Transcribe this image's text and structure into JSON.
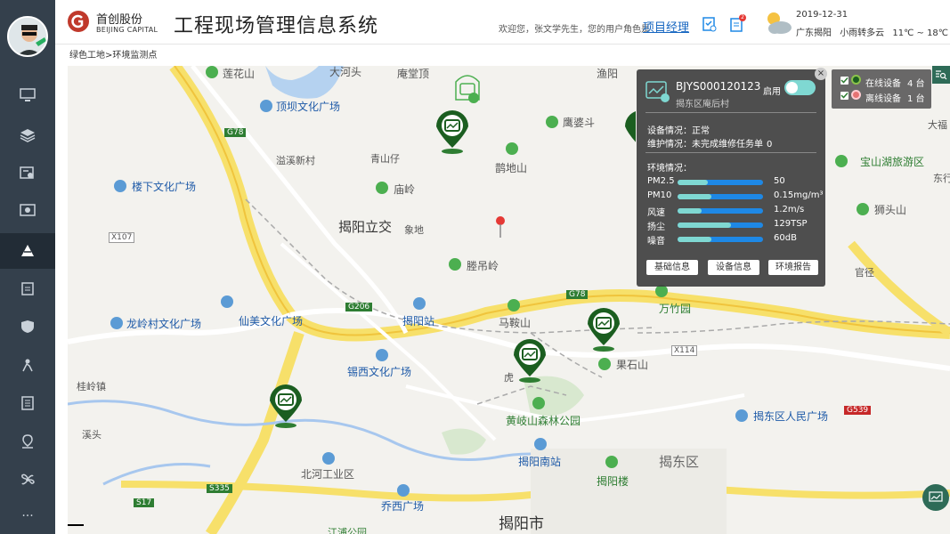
{
  "header": {
    "brand_cn": "首创股份",
    "brand_en": "BEIJING CAPITAL",
    "title": "工程现场管理信息系统",
    "welcome": "欢迎您，张文学先生，您的用户角色是",
    "role": "项目经理",
    "notice_count": "2",
    "date": "2019-12-31",
    "location": "广东揭阳",
    "weather": "小雨转多云",
    "temp": "11℃ ~ 18℃"
  },
  "breadcrumb": "绿色工地>环境监测点",
  "sidebar": {
    "items": [
      "monitor-icon",
      "layers-icon",
      "id-card-icon",
      "screen-icon",
      "crane-icon",
      "clipboard-icon",
      "shield-icon",
      "worker-icon",
      "document-icon",
      "location-icon",
      "fan-icon",
      "more-icon"
    ],
    "active_index": 4
  },
  "popup": {
    "device_id": "BJYS000120123",
    "address": "揭东区庵后村",
    "enable_label": "启用",
    "status_label": "设备情况：",
    "status_value": "正常",
    "maint_label": "维护情况：",
    "maint_value": "未完成维修任务单",
    "maint_count": "0",
    "env_label": "环境情况：",
    "metrics": [
      {
        "name": "PM2.5",
        "value": "50",
        "level": 0.35
      },
      {
        "name": "PM10",
        "value": "0.15mg/m³",
        "level": 0.4
      },
      {
        "name": "风速",
        "value": "1.2m/s",
        "level": 0.28
      },
      {
        "name": "扬尘",
        "value": "129TSP",
        "level": 0.62
      },
      {
        "name": "噪音",
        "value": "60dB",
        "level": 0.4
      }
    ],
    "buttons": [
      "基础信息",
      "设备信息",
      "环境报告"
    ]
  },
  "legend": {
    "online_label": "在线设备",
    "online_count": "4 台",
    "offline_label": "离线设备",
    "offline_count": "1 台"
  },
  "map": {
    "labels": {
      "lianhuashan": "莲花山",
      "dinghuan": "顶坝文化广场",
      "anshaicun": "溢溪新村",
      "qingshanzi": "青山仔",
      "louxia": "楼下文化广场",
      "miaoling": "庙岭",
      "jieyanglijiao": "揭阳立交",
      "xiangdi": "象地",
      "x107": "X107",
      "g78a": "G78",
      "g78b": "G78",
      "g206": "G206",
      "x114": "X114",
      "s335": "S335",
      "s17": "S17",
      "g539": "G539",
      "tengdiaoling": "塍吊岭",
      "longlingcun": "龙岭村文化广场",
      "xianmei": "仙美文化广场",
      "jieyangzhan": "揭阳站",
      "maanshan": "马鞍山",
      "wanzhuyuan": "万竹园",
      "xixi": "锡西文化广场",
      "guolinzhen": "桂岭镇",
      "huang": "黄岐山森林公园",
      "guoshishan": "果石山",
      "hu": "虎",
      "jieyangnan": "揭阳南站",
      "beihe": "北河工业区",
      "qiaoxi": "乔西广场",
      "jieyangshi": "揭阳市",
      "jiedongqu": "揭东区",
      "jiedongrenmin": "揭东区人民广场",
      "jieyanglou": "揭阳楼",
      "xitou": "溪头",
      "yingdi": "鹰婆斗",
      "quedishan": "鹊地山",
      "baoshanhu": "宝山湖旅游区",
      "shitoushan": "狮头山",
      "guanliao": "官径",
      "dafu": "大福",
      "dongxing": "东行",
      "yuyang": "渔阳",
      "andingtang": "庵堂顶",
      "dahe": "大河头",
      "jiangpu": "江浦公园"
    }
  }
}
